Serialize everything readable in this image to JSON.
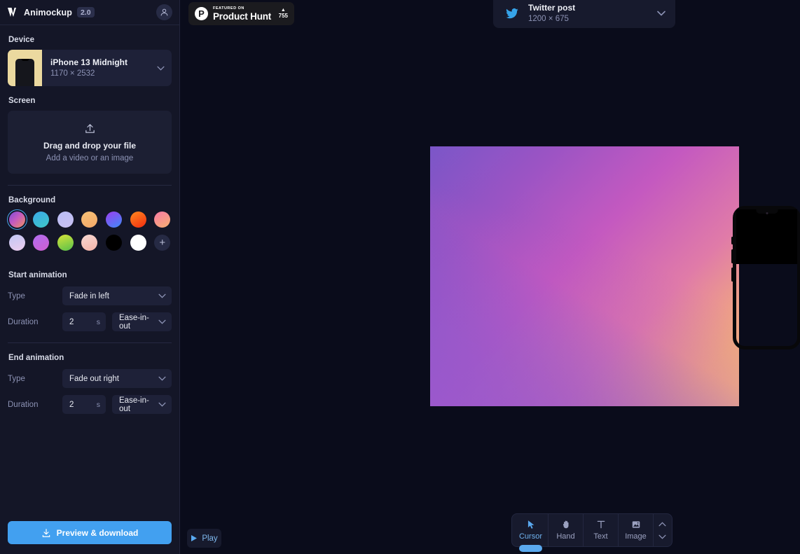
{
  "app": {
    "name": "Animockup",
    "version": "2.0",
    "logo_icon": "lightning-zigzag-icon",
    "avatar_icon": "user-avatar-icon"
  },
  "sidebar": {
    "sections": {
      "device": {
        "label": "Device",
        "name": "iPhone 13 Midnight",
        "dimensions": "1170 × 2532"
      },
      "screen": {
        "label": "Screen",
        "upload_icon": "upload-icon",
        "drop_title": "Drag and drop your file",
        "drop_subtitle": "Add a video or an image"
      },
      "background": {
        "label": "Background",
        "add_label": "+",
        "selected_index": 0,
        "swatches": [
          {
            "name": "purple-orange-gradient",
            "css": "linear-gradient(135deg,#7a4bd6 0%,#c45ac0 45%,#f0925f 100%)",
            "selected": true
          },
          {
            "name": "cyan-teal-gradient",
            "css": "linear-gradient(150deg,#3aa9e8 0%,#3fc6c6 100%)",
            "selected": false
          },
          {
            "name": "periwinkle-gradient",
            "css": "linear-gradient(160deg,#b9bdf5 0%,#c9c1f2 100%)",
            "selected": false
          },
          {
            "name": "peach-gradient",
            "css": "linear-gradient(160deg,#f7c177 0%,#f3a868 100%)",
            "selected": false
          },
          {
            "name": "blue-violet-gradient",
            "css": "linear-gradient(150deg,#9b3ef0 0%,#3f8bf5 100%)",
            "selected": false
          },
          {
            "name": "orange-red-gradient",
            "css": "linear-gradient(150deg,#ff8a1f 0%,#f32b10 100%)",
            "selected": false
          },
          {
            "name": "pink-orange-gradient",
            "css": "linear-gradient(150deg,#f97aa6 0%,#f6b070 100%)",
            "selected": false
          },
          {
            "name": "lavender-pink-gradient",
            "css": "linear-gradient(160deg,#c0c7f5 0%,#eecdee 100%)",
            "selected": false
          },
          {
            "name": "violet-magenta-gradient",
            "css": "linear-gradient(150deg,#b06ef0 0%,#d05ed0 100%)",
            "selected": false
          },
          {
            "name": "yellow-green-gradient",
            "css": "linear-gradient(160deg,#d7e43a 0%,#57c04a 100%)",
            "selected": false
          },
          {
            "name": "blush-gradient",
            "css": "linear-gradient(160deg,#f6d8d2 0%,#f5b3a8 100%)",
            "selected": false
          },
          {
            "name": "black-solid",
            "css": "#000000",
            "selected": false
          },
          {
            "name": "white-solid",
            "css": "#ffffff",
            "selected": false
          }
        ]
      },
      "start_animation": {
        "label": "Start animation",
        "type_label": "Type",
        "type_value": "Fade in left",
        "duration_label": "Duration",
        "duration_value": "2",
        "duration_unit": "s",
        "easing_value": "Ease-in-out"
      },
      "end_animation": {
        "label": "End animation",
        "type_label": "Type",
        "type_value": "Fade out right",
        "duration_label": "Duration",
        "duration_value": "2",
        "duration_unit": "s",
        "easing_value": "Ease-in-out"
      }
    },
    "download_button": {
      "label": "Preview & download",
      "icon": "download-icon",
      "color": "#42a0f0"
    }
  },
  "canvas": {
    "background_color": "#0a0c1b",
    "product_hunt_badge": {
      "featured_text": "FEATURED ON",
      "name": "Product Hunt",
      "upvote_icon": "triangle-up-icon",
      "upvote_count": "755"
    },
    "size_selector": {
      "icon": "twitter-bird-icon",
      "title": "Twitter post",
      "dimensions": "1200 × 675"
    },
    "artboard": {
      "gradient_corners": {
        "top_left": "#7b56c8",
        "top_right": "#fbc96c",
        "bottom_left": "#4459d0",
        "bottom_right": "#d957c8"
      },
      "device_mock": "iphone-13-midnight-mockup"
    },
    "play_button": {
      "label": "Play",
      "icon": "play-triangle-icon"
    },
    "toolbar": {
      "tools": [
        {
          "label": "Cursor",
          "icon": "cursor-arrow-icon",
          "active": true
        },
        {
          "label": "Hand",
          "icon": "hand-icon",
          "active": false
        },
        {
          "label": "Text",
          "icon": "text-t-icon",
          "active": false
        },
        {
          "label": "Image",
          "icon": "image-icon",
          "active": false
        }
      ],
      "stepper_up_icon": "chevron-up-icon",
      "stepper_down_icon": "chevron-down-icon"
    }
  }
}
